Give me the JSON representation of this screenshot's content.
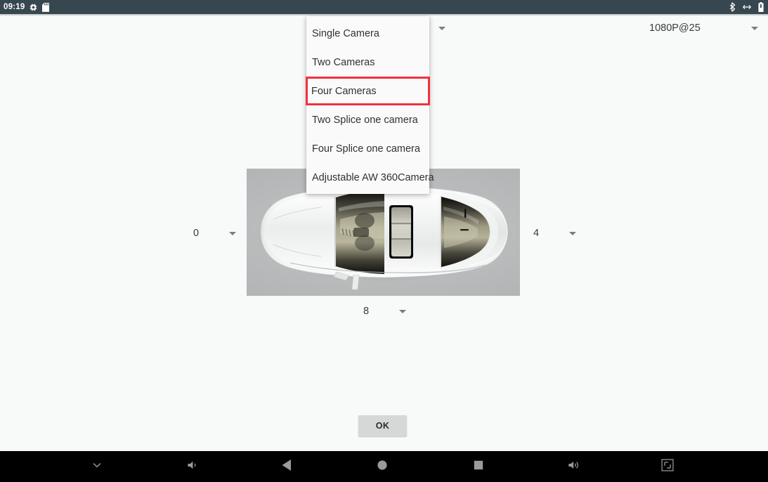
{
  "status_bar": {
    "clock": "09:19",
    "left_icons": [
      "settings-gear-icon",
      "sd-card-icon"
    ],
    "right_icons": [
      "bluetooth-icon",
      "usb-data-transfer-icon",
      "battery-icon"
    ],
    "background_color": "#37474f"
  },
  "camera_mode_spinner": {
    "value": "Four Cameras",
    "caret_icon": "chevron-down-icon"
  },
  "resolution_spinner": {
    "value": "1080P@25",
    "caret_icon": "chevron-down-icon"
  },
  "camera_mode_menu": {
    "items": [
      {
        "label": "Single Camera",
        "selected": false
      },
      {
        "label": "Two Cameras",
        "selected": false
      },
      {
        "label": "Four Cameras",
        "selected": true
      },
      {
        "label": "Two Splice one camera",
        "selected": false
      },
      {
        "label": "Four Splice one camera",
        "selected": false
      },
      {
        "label": "Adjustable AW 360Camera",
        "selected": false
      }
    ],
    "highlight_color": "#f4303c",
    "background_color": "#fafafa"
  },
  "camera_position_spinners": {
    "left": {
      "value": "0",
      "caret_icon": "chevron-down-icon"
    },
    "right": {
      "value": "4",
      "caret_icon": "chevron-down-icon"
    },
    "bottom": {
      "value": "8",
      "caret_icon": "chevron-down-icon"
    }
  },
  "car_preview": {
    "alt": "top-down-car-diagram",
    "background_color": "#b9bbbc"
  },
  "actions": {
    "ok_label": "OK"
  },
  "nav_bar": {
    "background_color": "#000000",
    "buttons": [
      {
        "name": "hide-navbar-button",
        "icon": "chevron-down-icon"
      },
      {
        "name": "volume-down-button",
        "icon": "volume-down-icon"
      },
      {
        "name": "back-button",
        "icon": "back-triangle-icon"
      },
      {
        "name": "home-button",
        "icon": "home-circle-icon"
      },
      {
        "name": "recents-button",
        "icon": "recents-square-icon"
      },
      {
        "name": "volume-up-button",
        "icon": "volume-up-icon"
      },
      {
        "name": "screenshot-button",
        "icon": "screenshot-crop-icon"
      }
    ]
  }
}
